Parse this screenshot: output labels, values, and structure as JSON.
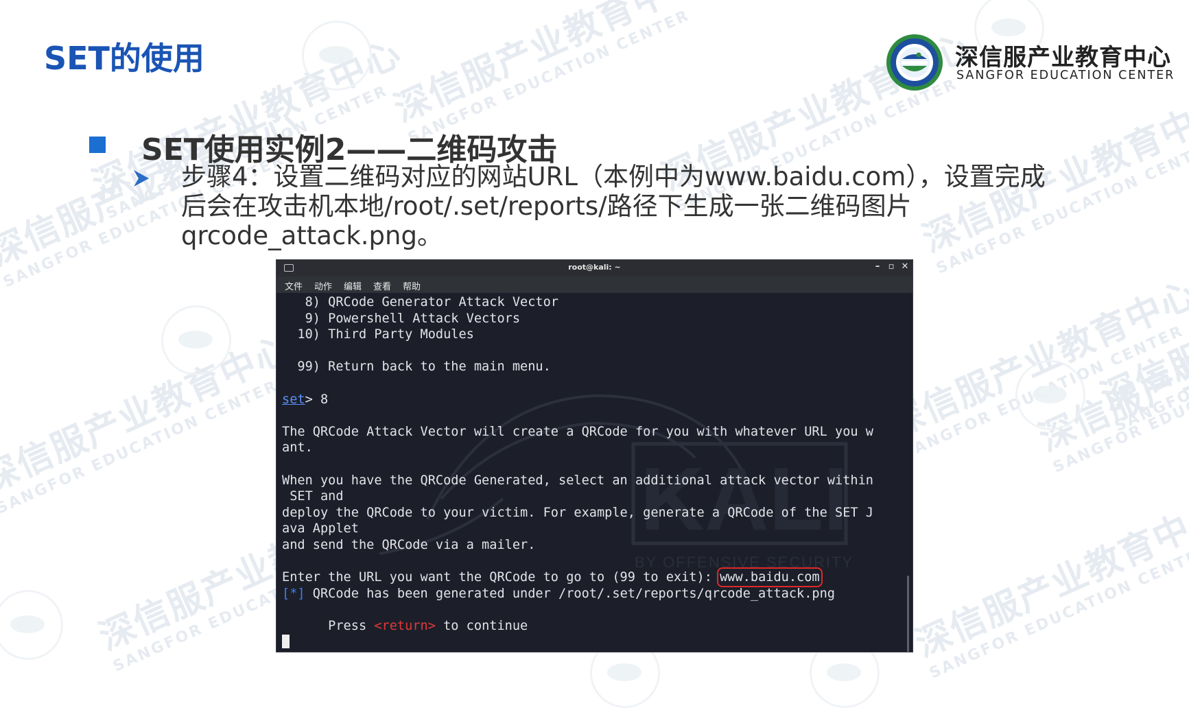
{
  "slide": {
    "title": "SET的使用",
    "section_heading": "SET使用实例2——二维码攻击",
    "step_text": "步骤4：设置二维码对应的网站URL（本例中为www.baidu.com），设置完成\n后会在攻击机本地/root/.set/reports/路径下生成一张二维码图片\nqrcode_attack.png。"
  },
  "brand": {
    "name_cn": "深信服产业教育中心",
    "name_en": "SANGFOR EDUCATION CENTER",
    "logo_icon": "sangfor-education-logo"
  },
  "watermark": {
    "cn": "深信服产业教育中心",
    "en": "SANGFOR EDUCATION CENTER"
  },
  "terminal": {
    "title": "root@kali: ~",
    "controls": {
      "minimize": "–",
      "maximize": "▫",
      "close": "✕"
    },
    "menu": [
      "文件",
      "动作",
      "编辑",
      "查看",
      "帮助"
    ],
    "watermark_text": "BY OFFENSIVE SECURITY",
    "lines": [
      "   8) QRCode Generator Attack Vector",
      "   9) Powershell Attack Vectors",
      "  10) Third Party Modules",
      "",
      "  99) Return back to the main menu.",
      "",
      "",
      "",
      "The QRCode Attack Vector will create a QRCode for you with whatever URL you w",
      "ant.",
      "",
      "When you have the QRCode Generated, select an additional attack vector within",
      " SET and",
      "deploy the QRCode to your victim. For example, generate a QRCode of the SET J",
      "ava Applet",
      "and send the QRCode via a mailer.",
      ""
    ],
    "prompt": {
      "label": "set",
      "suffix": "> 8"
    },
    "url_prompt": "Enter the URL you want the QRCode to go to (99 to exit): ",
    "url_value": "www.baidu.com",
    "result_marker": "[*]",
    "result_text": " QRCode has been generated under /root/.set/reports/qrcode_attack.png",
    "press_prefix": "      Press ",
    "press_key": "<return>",
    "press_suffix": " to continue"
  },
  "colors": {
    "title_blue": "#1a54b4",
    "bullet_blue": "#1a6fd0",
    "terminal_bg": "#1c1f2a",
    "highlight_red": "#e02828",
    "link_blue": "#5b8ff2"
  }
}
